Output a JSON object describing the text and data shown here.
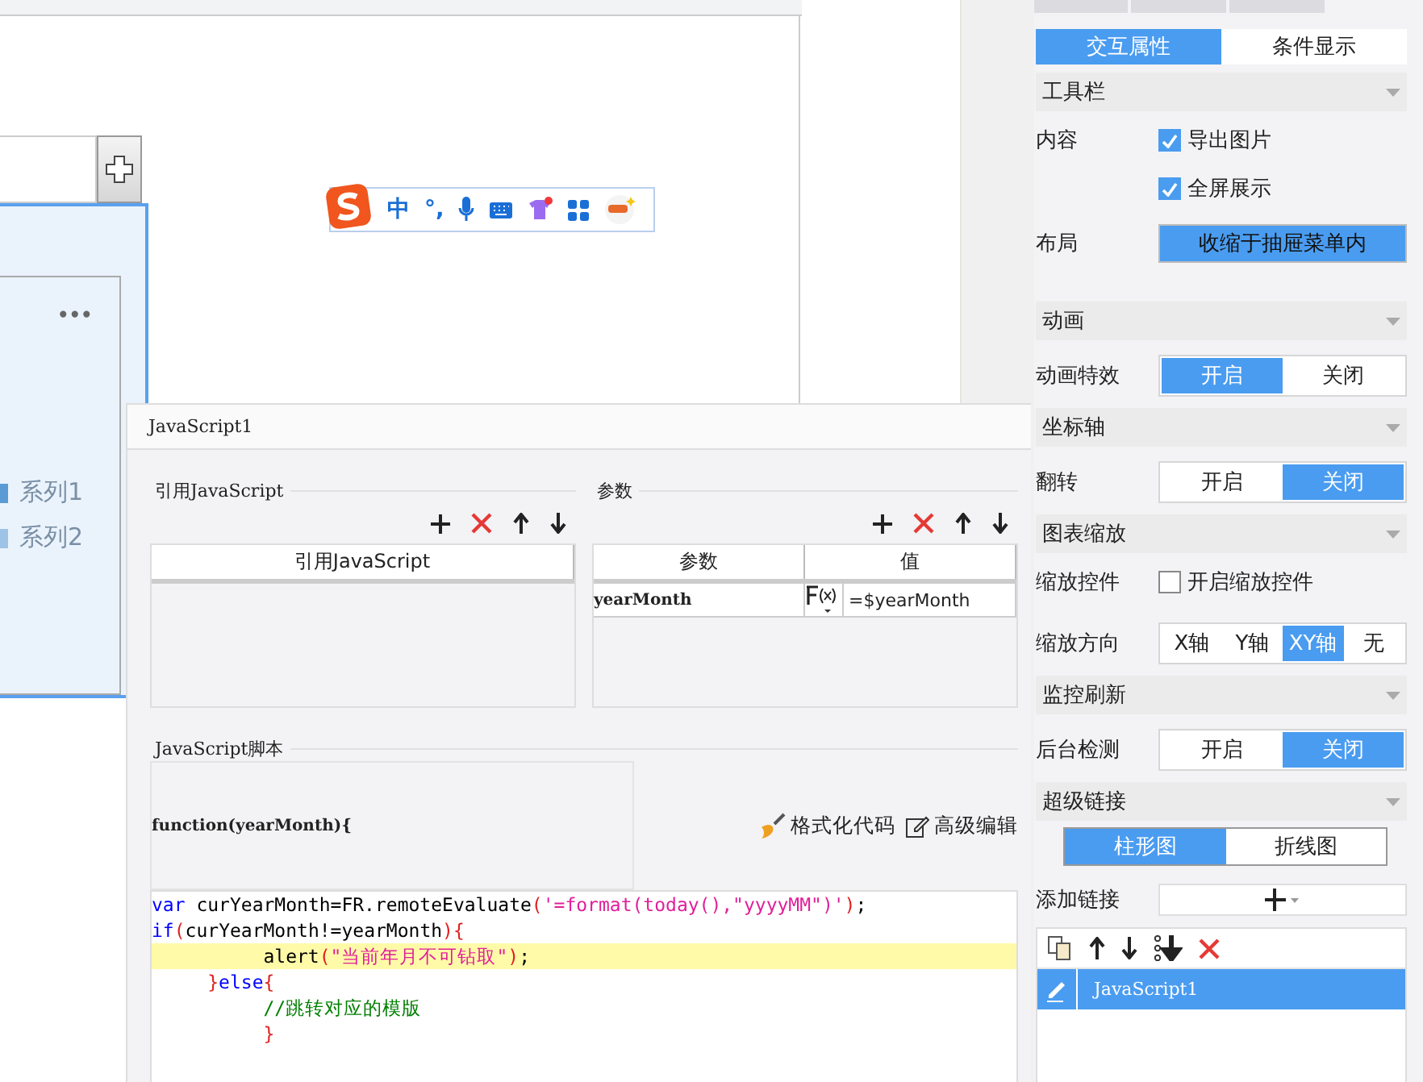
{
  "canvas": {
    "ime_toolbar": {
      "mode": "中",
      "punctuation": "°,"
    },
    "widget": {
      "menu": "•••",
      "legend": [
        {
          "label": "系列1",
          "color": "#5b9bd5"
        },
        {
          "label": "系列2",
          "color": "#9dc3e6"
        }
      ]
    }
  },
  "dialog": {
    "title": "JavaScript1",
    "reference": {
      "title": "引用JavaScript",
      "column": "引用JavaScript"
    },
    "params": {
      "title": "参数",
      "columns": [
        "参数",
        "值"
      ],
      "rows": [
        {
          "name": "yearMonth",
          "value": "=$yearMonth"
        }
      ]
    },
    "script": {
      "title": "JavaScript脚本",
      "signature": "function(yearMonth){",
      "actions": [
        "格式化代码",
        "高级编辑"
      ],
      "lines": [
        {
          "highlighted": false,
          "tokens": [
            {
              "kind": "keyword",
              "text": "var"
            },
            {
              "kind": "plain",
              "text": " curYearMonth=FR.remoteEvaluate"
            },
            {
              "kind": "brace",
              "text": "("
            },
            {
              "kind": "string",
              "text": "'=format(today(),\"yyyyMM\")'"
            },
            {
              "kind": "brace",
              "text": ")"
            },
            {
              "kind": "plain",
              "text": ";"
            }
          ]
        },
        {
          "highlighted": false,
          "tokens": [
            {
              "kind": "keyword",
              "text": "if"
            },
            {
              "kind": "brace",
              "text": "("
            },
            {
              "kind": "plain",
              "text": "curYearMonth!=yearMonth"
            },
            {
              "kind": "brace",
              "text": "){"
            }
          ]
        },
        {
          "highlighted": true,
          "tokens": [
            {
              "kind": "plain",
              "text": "          alert"
            },
            {
              "kind": "brace",
              "text": "("
            },
            {
              "kind": "string",
              "text": "\"当前年月不可钻取\""
            },
            {
              "kind": "brace",
              "text": ")"
            },
            {
              "kind": "plain",
              "text": ";"
            }
          ]
        },
        {
          "highlighted": false,
          "tokens": [
            {
              "kind": "brace",
              "text": "     }"
            },
            {
              "kind": "keyword",
              "text": "else"
            },
            {
              "kind": "brace",
              "text": "{"
            }
          ]
        },
        {
          "highlighted": false,
          "tokens": [
            {
              "kind": "comment",
              "text": "          //跳转对应的模版"
            }
          ]
        },
        {
          "highlighted": false,
          "tokens": [
            {
              "kind": "brace",
              "text": "          }"
            }
          ]
        }
      ]
    }
  },
  "panel": {
    "mode_tabs": [
      {
        "label": "交互属性",
        "selected": true
      },
      {
        "label": "条件显示",
        "selected": false
      }
    ],
    "sections": [
      {
        "title": "工具栏",
        "rows": [
          {
            "kind": "checks",
            "label": "内容",
            "options": [
              {
                "label": "导出图片",
                "checked": true
              },
              {
                "label": "全屏展示",
                "checked": true
              }
            ]
          },
          {
            "kind": "dropdown",
            "label": "布局",
            "value": "收缩于抽屉菜单内"
          }
        ]
      },
      {
        "title": "动画",
        "rows": [
          {
            "kind": "segmented",
            "label": "动画特效",
            "options": [
              {
                "label": "开启",
                "selected": true
              },
              {
                "label": "关闭",
                "selected": false
              }
            ]
          }
        ]
      },
      {
        "title": "坐标轴",
        "rows": [
          {
            "kind": "segmented",
            "label": "翻转",
            "options": [
              {
                "label": "开启",
                "selected": false
              },
              {
                "label": "关闭",
                "selected": true
              }
            ]
          }
        ]
      },
      {
        "title": "图表缩放",
        "rows": [
          {
            "kind": "checks",
            "label": "缩放控件",
            "options": [
              {
                "label": "开启缩放控件",
                "checked": false
              }
            ]
          },
          {
            "kind": "segmented",
            "label": "缩放方向",
            "options": [
              {
                "label": "X轴",
                "selected": false
              },
              {
                "label": "Y轴",
                "selected": false
              },
              {
                "label": "XY轴",
                "selected": true
              },
              {
                "label": "无",
                "selected": false
              }
            ]
          }
        ]
      },
      {
        "title": "监控刷新",
        "rows": [
          {
            "kind": "segmented",
            "label": "后台检测",
            "options": [
              {
                "label": "开启",
                "selected": false
              },
              {
                "label": "关闭",
                "selected": true
              }
            ]
          }
        ]
      },
      {
        "title": "超级链接",
        "rows": [
          {
            "kind": "tabs",
            "options": [
              {
                "label": "柱形图",
                "selected": true
              },
              {
                "label": "折线图",
                "selected": false
              }
            ]
          },
          {
            "kind": "add",
            "label": "添加链接"
          },
          {
            "kind": "list",
            "items": [
              {
                "label": "JavaScript1",
                "selected": true
              }
            ]
          }
        ]
      }
    ]
  }
}
